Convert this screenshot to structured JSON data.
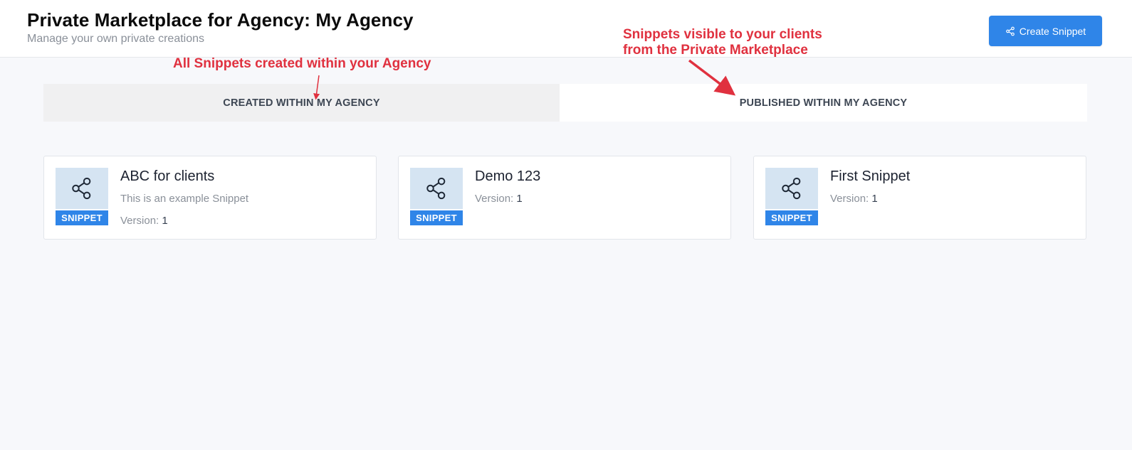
{
  "header": {
    "title": "Private Marketplace for Agency: My Agency",
    "subtitle": "Manage your own private creations",
    "create_button_label": "Create Snippet"
  },
  "annotations": {
    "created": "All Snippets created within your Agency",
    "published_line1": "Snippets visible to your clients",
    "published_line2": "from the Private Marketplace"
  },
  "tabs": [
    {
      "label": "CREATED WITHIN MY AGENCY",
      "active": true
    },
    {
      "label": "PUBLISHED WITHIN MY AGENCY",
      "active": false
    }
  ],
  "cards": [
    {
      "title": "ABC for clients",
      "description": "This is an example Snippet",
      "version_label": "Version:",
      "version": "1",
      "badge": "SNIPPET",
      "icon": "share-icon"
    },
    {
      "title": "Demo 123",
      "description": "",
      "version_label": "Version:",
      "version": "1",
      "badge": "SNIPPET",
      "icon": "share-icon"
    },
    {
      "title": "First Snippet",
      "description": "",
      "version_label": "Version:",
      "version": "1",
      "badge": "SNIPPET",
      "icon": "share-icon"
    }
  ],
  "colors": {
    "accent": "#2f85e8",
    "annotation": "#e0313f",
    "thumb_bg": "#d5e4f2"
  }
}
